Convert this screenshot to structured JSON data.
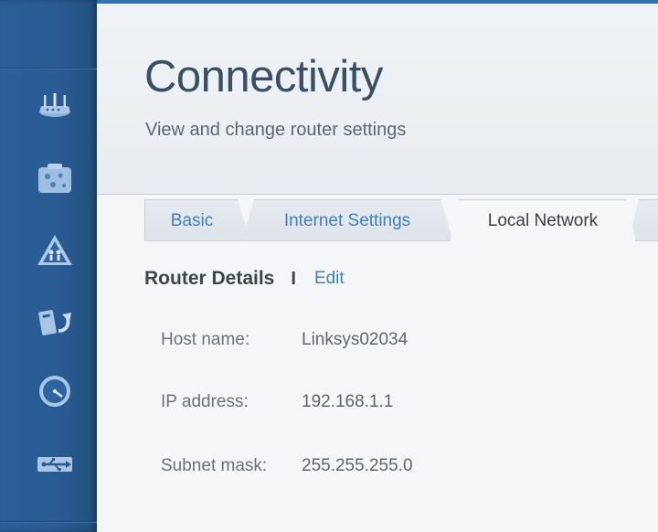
{
  "header": {
    "title": "Connectivity",
    "subtitle": "View and change router settings"
  },
  "tabs": [
    {
      "label": "Basic",
      "active": false
    },
    {
      "label": "Internet Settings",
      "active": false
    },
    {
      "label": "Local Network",
      "active": true
    },
    {
      "label": "",
      "active": false
    }
  ],
  "section": {
    "title": "Router Details",
    "divider": "I",
    "edit_label": "Edit"
  },
  "details": [
    {
      "label": "Host name:",
      "value": "Linksys02034"
    },
    {
      "label": "IP address:",
      "value": "192.168.1.1"
    },
    {
      "label": "Subnet mask:",
      "value": "255.255.255.0"
    }
  ],
  "sidebar": {
    "icons": [
      "router-icon",
      "devices-icon",
      "warning-icon",
      "restore-icon",
      "speedometer-icon",
      "usb-icon"
    ]
  },
  "colors": {
    "sidebar": "#2a5b93",
    "accent_link": "#3f7fbd",
    "title_text": "#3a4f63"
  }
}
